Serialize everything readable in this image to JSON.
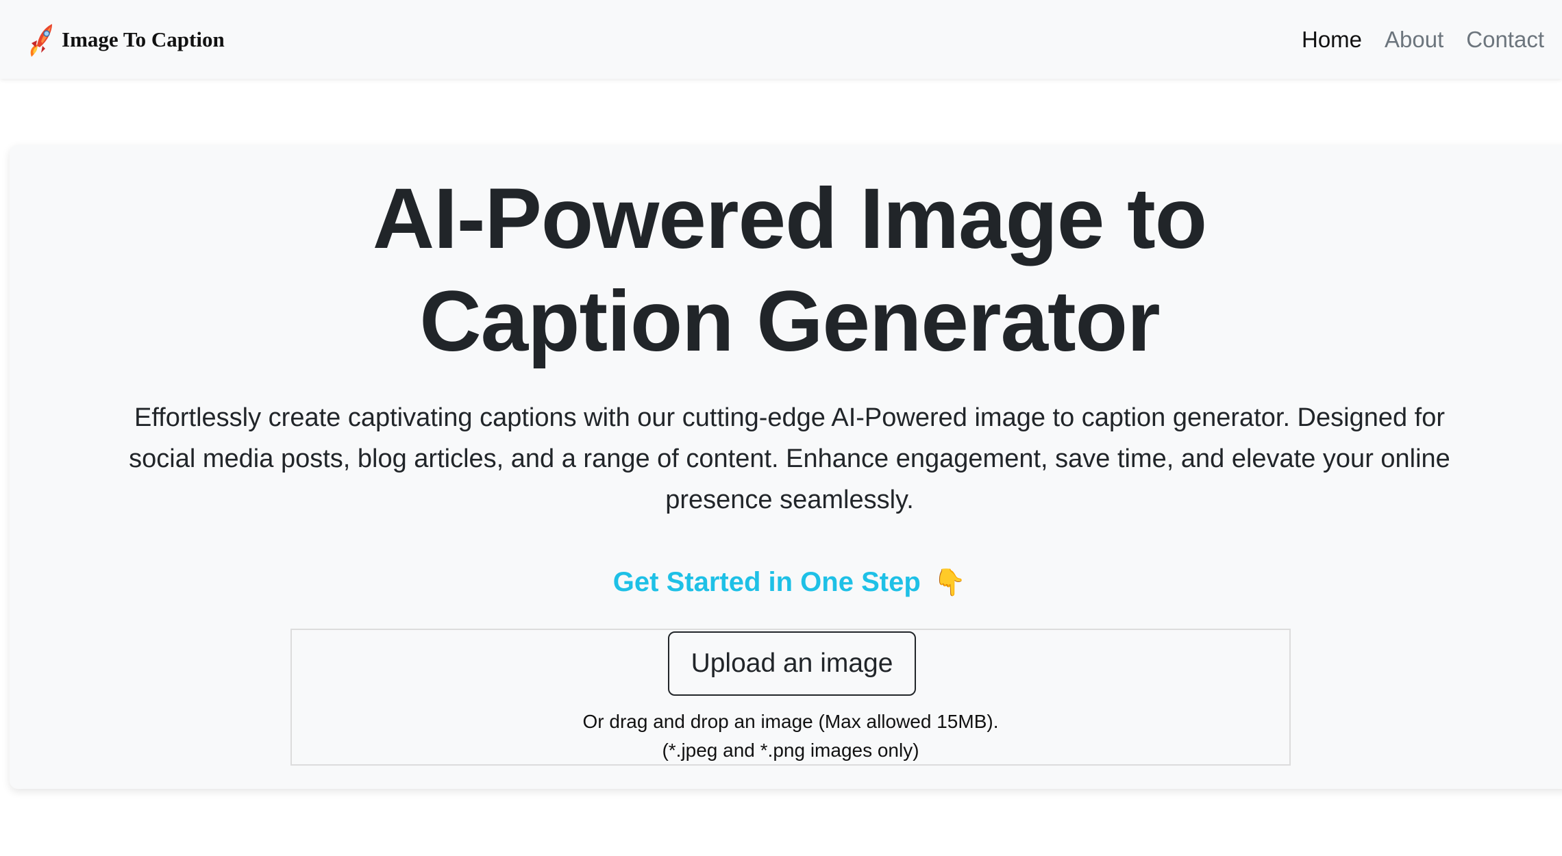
{
  "navbar": {
    "brand": "Image To Caption",
    "links": [
      {
        "label": "Home",
        "active": true
      },
      {
        "label": "About",
        "active": false
      },
      {
        "label": "Contact",
        "active": false
      }
    ]
  },
  "hero": {
    "title_line1": "AI-Powered Image to",
    "title_line2": "Caption Generator",
    "description": "Effortlessly create captivating captions with our cutting-edge AI-Powered image to caption generator. Designed for social media posts, blog articles, and a range of content. Enhance engagement, save time, and elevate your online presence seamlessly.",
    "get_started": "Get Started in One Step",
    "get_started_emoji": "👇"
  },
  "upload": {
    "button_label": "Upload an image",
    "hint_line1": "Or drag and drop an image (Max allowed 15MB).",
    "hint_line2": "(*.jpeg and *.png images only)"
  },
  "colors": {
    "accent": "#1ec0e6",
    "text": "#212529",
    "muted": "#6c757d",
    "panel": "#f8f9fa"
  },
  "icons": {
    "brand_logo": "rocket-icon",
    "get_started": "pointing-down-icon"
  }
}
